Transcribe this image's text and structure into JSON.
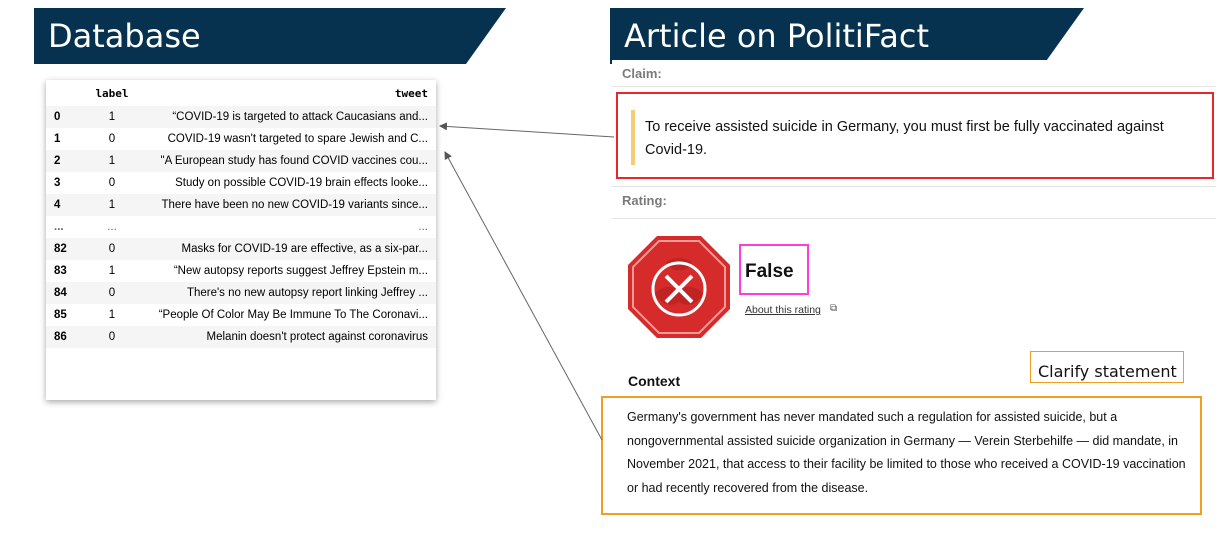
{
  "banners": {
    "left_title": "Database",
    "right_title": "Article on PolitiFact",
    "color": "#06324f"
  },
  "dataframe": {
    "columns": [
      "label",
      "tweet"
    ],
    "rows": [
      {
        "index": "0",
        "label": "1",
        "tweet": "“COVID-19 is targeted to attack Caucasians and..."
      },
      {
        "index": "1",
        "label": "0",
        "tweet": "COVID-19 wasn't targeted to spare Jewish and C..."
      },
      {
        "index": "2",
        "label": "1",
        "tweet": "\"A European study has found COVID vaccines cou..."
      },
      {
        "index": "3",
        "label": "0",
        "tweet": "Study on possible COVID-19 brain effects looke..."
      },
      {
        "index": "4",
        "label": "1",
        "tweet": "There have been no new COVID-19 variants since..."
      },
      {
        "index": "...",
        "label": "...",
        "tweet": "..."
      },
      {
        "index": "82",
        "label": "0",
        "tweet": "Masks for COVID-19 are effective, as a six-par..."
      },
      {
        "index": "83",
        "label": "1",
        "tweet": "“New autopsy reports suggest Jeffrey Epstein m..."
      },
      {
        "index": "84",
        "label": "0",
        "tweet": "There's no new autopsy report linking Jeffrey ..."
      },
      {
        "index": "85",
        "label": "1",
        "tweet": "“People Of Color May Be Immune To The Coronavi..."
      },
      {
        "index": "86",
        "label": "0",
        "tweet": "Melanin doesn't protect against coronavirus"
      }
    ]
  },
  "article": {
    "claim_label": "Claim:",
    "claim_text": "To receive assisted suicide in Germany, you must first be fully vaccinated against Covid-19.",
    "rating_label": "Rating:",
    "rating_value": "False",
    "rating_icon": "stop-sign-x-icon",
    "about_rating": "About this rating",
    "context_title": "Context",
    "context_text": "Germany's government has never mandated such a regulation for assisted suicide, but a nongovernmental assisted suicide organization in Germany — Verein Sterbehilfe — did mandate, in November 2021, that access to their facility be limited to those who received a COVID-19 vaccination or had recently recovered from the disease.",
    "annotation": "Clarify statement"
  },
  "colors": {
    "claim_highlight": "#e8262b",
    "rating_highlight": "#ff3dd9",
    "context_highlight": "#f0a020",
    "rating_red": "#d62b2b"
  }
}
